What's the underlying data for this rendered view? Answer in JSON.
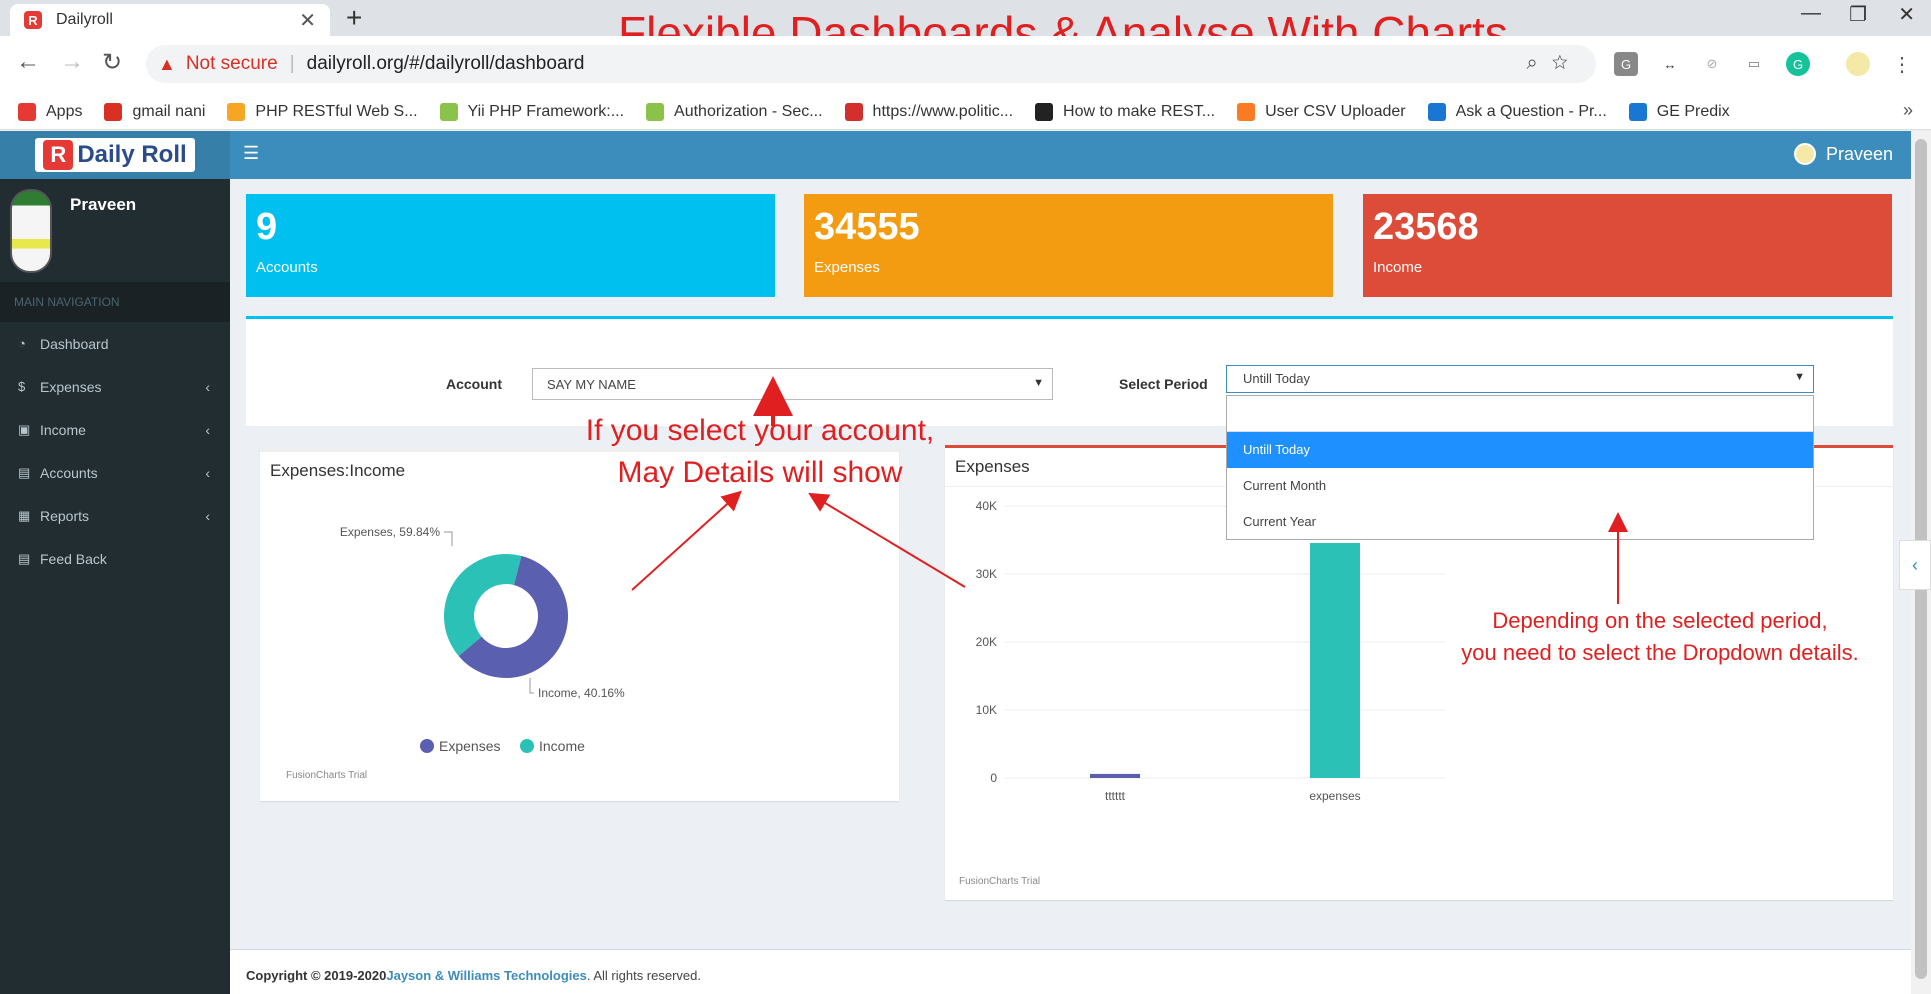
{
  "browser": {
    "tab_title": "Dailyroll",
    "tab_close": "✕",
    "new_tab": "+",
    "security_label": "Not secure",
    "url": "dailyroll.org/#/dailyroll/dashboard",
    "bookmarks": [
      {
        "label": "Apps",
        "icon": "apps-grid-icon",
        "color": "#e53935"
      },
      {
        "label": "gmail nani",
        "icon": "gmail-icon",
        "color": "#d93025"
      },
      {
        "label": "PHP RESTful Web S...",
        "icon": "php-icon",
        "color": "#f5a623"
      },
      {
        "label": "Yii PHP Framework:...",
        "icon": "yii-icon",
        "color": "#8bc34a"
      },
      {
        "label": "Authorization - Sec...",
        "icon": "yii-icon",
        "color": "#8bc34a"
      },
      {
        "label": "https://www.politic...",
        "icon": "politico-icon",
        "color": "#d32f2f"
      },
      {
        "label": "How to make REST...",
        "icon": "book-icon",
        "color": "#222222"
      },
      {
        "label": "User CSV Uploader",
        "icon": "xampp-icon",
        "color": "#fb7a24"
      },
      {
        "label": "Ask a Question - Pr...",
        "icon": "predix-icon",
        "color": "#1976d2"
      },
      {
        "label": "GE Predix",
        "icon": "predix-icon",
        "color": "#1976d2"
      }
    ]
  },
  "overlay_title": "Flexible Dashboards & Analyse With Charts",
  "app": {
    "logo_text": "Daily Roll",
    "logo_letter": "R",
    "user_name": "Praveen",
    "nav_header": "MAIN NAVIGATION",
    "nav_items": [
      {
        "label": "Dashboard",
        "icon": "pie-icon",
        "glyph": "◔",
        "has_children": false
      },
      {
        "label": "Expenses",
        "icon": "dollar-icon",
        "glyph": "$",
        "has_children": true
      },
      {
        "label": "Income",
        "icon": "money-icon",
        "glyph": "▣",
        "has_children": true
      },
      {
        "label": "Accounts",
        "icon": "account-icon",
        "glyph": "▤",
        "has_children": true
      },
      {
        "label": "Reports",
        "icon": "grid-icon",
        "glyph": "▦",
        "has_children": true
      },
      {
        "label": "Feed Back",
        "icon": "feedback-icon",
        "glyph": "▤",
        "has_children": false
      }
    ],
    "stats": [
      {
        "value": "9",
        "label": "Accounts",
        "color": "#00c0ef"
      },
      {
        "value": "34555",
        "label": "Expenses",
        "color": "#f39c12"
      },
      {
        "value": "23568",
        "label": "Income",
        "color": "#dd4b39"
      }
    ],
    "filters": {
      "account_label": "Account",
      "account_value": "SAY MY NAME",
      "period_label": "Select Period",
      "period_value": "Untill Today",
      "period_options": [
        "Untill Today",
        "Current Month",
        "Current Year"
      ]
    },
    "footer": {
      "copyright": "Copyright © 2019-2020",
      "company": "Jayson & Williams Technologies",
      "rights": ". All rights reserved."
    }
  },
  "annotations": {
    "left_line1": "If you select your account,",
    "left_line2": "May Details will show",
    "right_line1": "Depending on the selected period,",
    "right_line2": "you need to select the Dropdown details."
  },
  "chart_data": [
    {
      "type": "pie",
      "title": "Expenses:Income",
      "slices": [
        {
          "name": "Expenses",
          "value": 59.84,
          "label": "Expenses, 59.84%",
          "color": "#5b5fb0"
        },
        {
          "name": "Income",
          "value": 40.16,
          "label": "Income, 40.16%",
          "color": "#2bc1b6"
        }
      ],
      "legend": [
        "Expenses",
        "Income"
      ],
      "legend_placement": "bottom",
      "watermark": "FusionCharts Trial"
    },
    {
      "type": "bar",
      "title": "Expenses",
      "categories": [
        "tttttt",
        "expenses"
      ],
      "values": [
        600,
        34555
      ],
      "colors": [
        "#5b5fb0",
        "#2bc1b6"
      ],
      "y_ticks": [
        "0",
        "10K",
        "20K",
        "30K",
        "40K"
      ],
      "ylim": [
        0,
        40000
      ],
      "grid": true,
      "watermark": "FusionCharts Trial"
    }
  ]
}
